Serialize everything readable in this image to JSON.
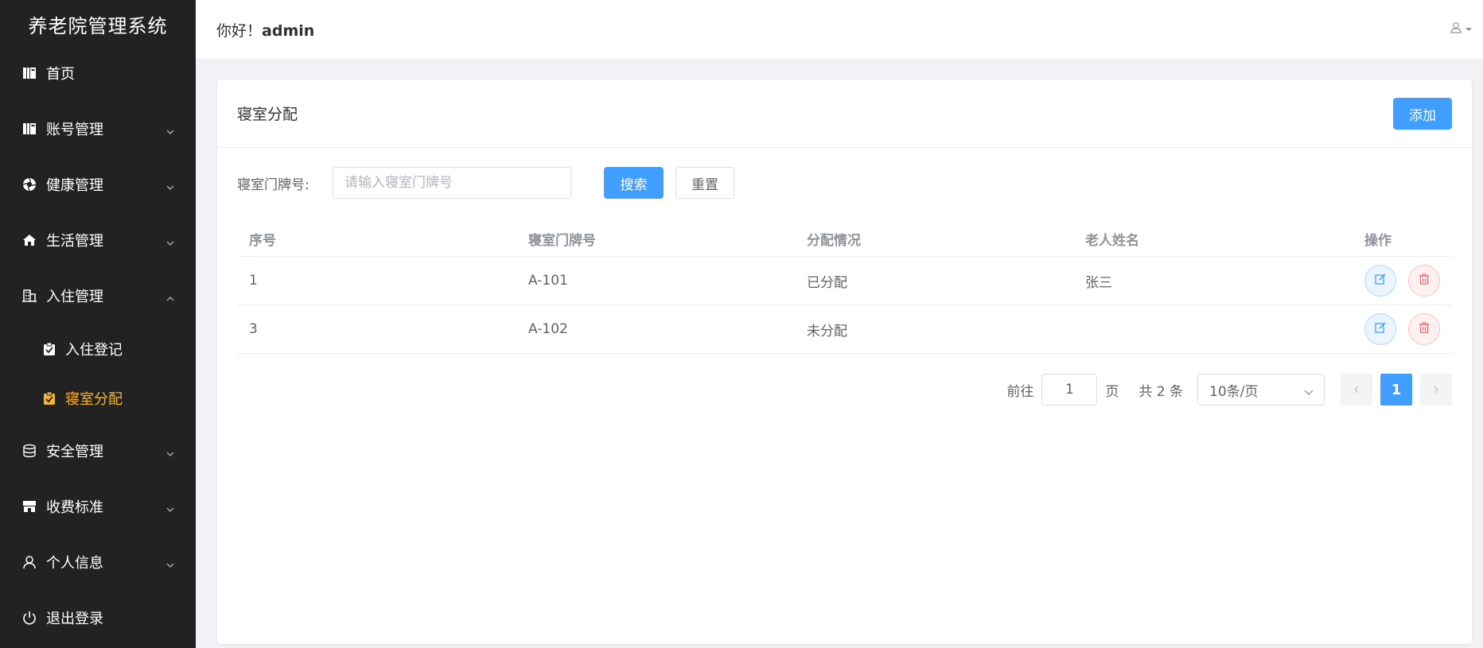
{
  "app": {
    "title": "养老院管理系统"
  },
  "header": {
    "greeting": "你好！",
    "username": "admin"
  },
  "sidebar": {
    "items": [
      {
        "label": "首页"
      },
      {
        "label": "账号管理"
      },
      {
        "label": "健康管理"
      },
      {
        "label": "生活管理"
      },
      {
        "label": "入住管理"
      },
      {
        "label": "入住登记"
      },
      {
        "label": "寝室分配"
      },
      {
        "label": "安全管理"
      },
      {
        "label": "收费标准"
      },
      {
        "label": "个人信息"
      },
      {
        "label": "退出登录"
      }
    ]
  },
  "card": {
    "title": "寝室分配",
    "add_label": "添加"
  },
  "search": {
    "label": "寝室门牌号:",
    "placeholder": "请输入寝室门牌号",
    "search_label": "搜索",
    "reset_label": "重置"
  },
  "table": {
    "headers": [
      "序号",
      "寝室门牌号",
      "分配情况",
      "老人姓名",
      "操作"
    ],
    "rows": [
      [
        "1",
        "A-101",
        "已分配",
        "张三"
      ],
      [
        "3",
        "A-102",
        "未分配",
        ""
      ]
    ]
  },
  "pager": {
    "goto_prefix": "前往",
    "goto_value": "1",
    "goto_suffix": "页",
    "total": "共 2 条",
    "page_size": "10条/页",
    "current": "1"
  },
  "colors": {
    "sidebar_bg": "#222222",
    "active": "#f3b634",
    "primary": "#409eff"
  }
}
